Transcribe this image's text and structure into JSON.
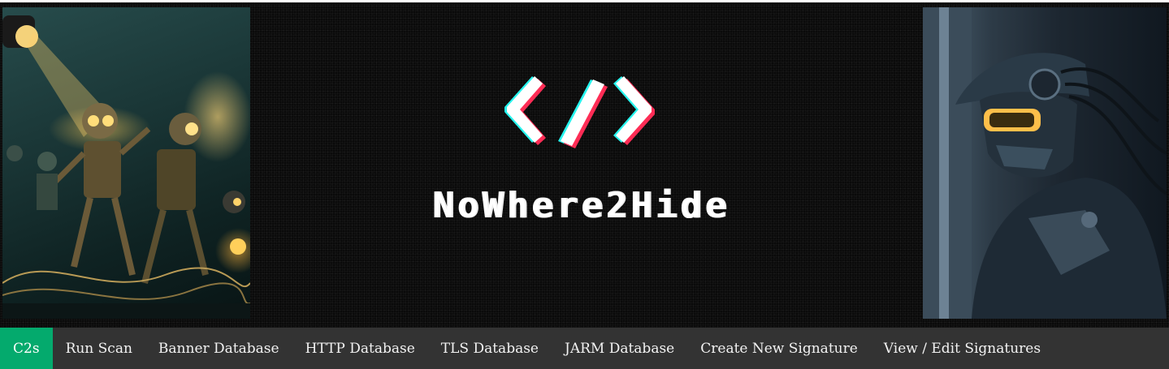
{
  "site": {
    "title": "NoWhere2Hide"
  },
  "banner": {
    "logo_icon": "code-brackets-icon",
    "left_image": "robots-dancing-illustration",
    "right_image": "cyborg-hacker-illustration"
  },
  "nav": {
    "active_color": "#04aa6d",
    "background_color": "#333333",
    "items": [
      {
        "label": "C2s",
        "active": true
      },
      {
        "label": "Run Scan",
        "active": false
      },
      {
        "label": "Banner Database",
        "active": false
      },
      {
        "label": "HTTP Database",
        "active": false
      },
      {
        "label": "TLS Database",
        "active": false
      },
      {
        "label": "JARM Database",
        "active": false
      },
      {
        "label": "Create New Signature",
        "active": false
      },
      {
        "label": "View / Edit Signatures",
        "active": false
      }
    ]
  }
}
